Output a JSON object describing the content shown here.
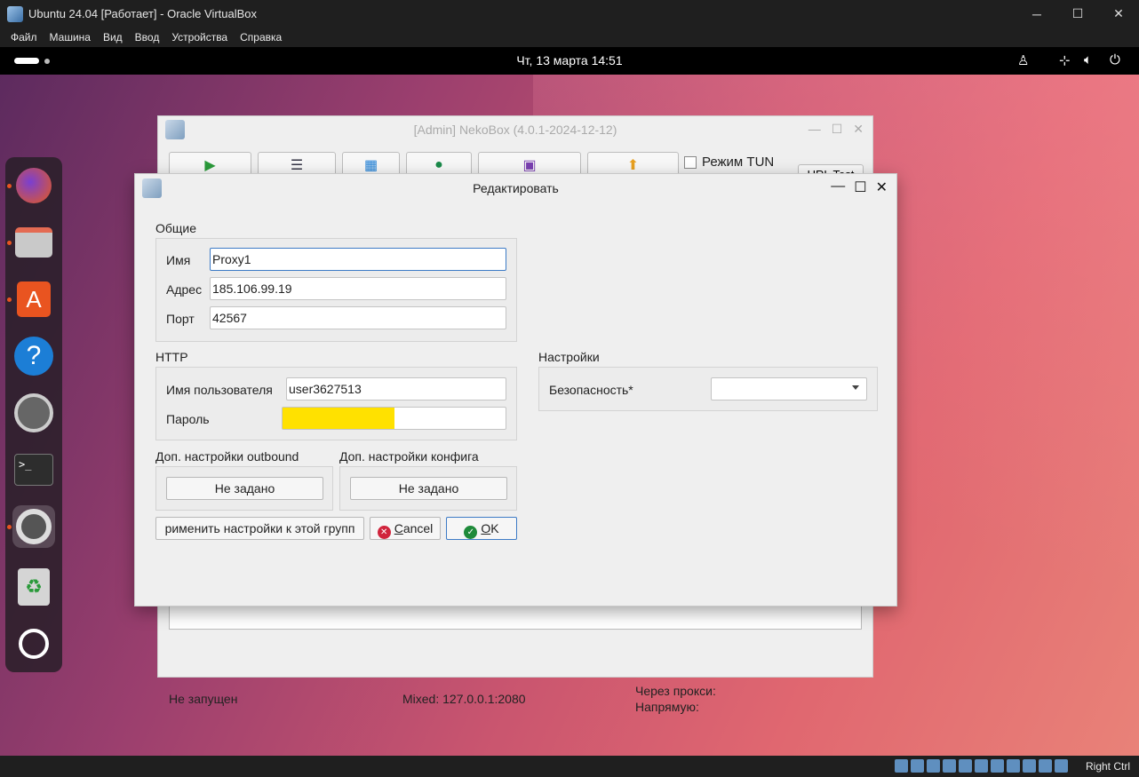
{
  "vbox": {
    "title": "Ubuntu 24.04 [Работает] - Oracle VirtualBox",
    "menu": [
      "Файл",
      "Машина",
      "Вид",
      "Ввод",
      "Устройства",
      "Справка"
    ],
    "host_key": "Right Ctrl"
  },
  "ubuntu": {
    "clock": "Чт, 13 марта  14:51"
  },
  "nekobox": {
    "title": "[Admin] NekoBox (4.0.1-2024-12-12)",
    "tun_label": "Режим TUN",
    "url_button": "URL Test",
    "status": {
      "state": "Не запущен",
      "mixed": "Mixed: 127.0.0.1:2080",
      "via_proxy": "Через прокси:",
      "direct": "Напрямую:"
    }
  },
  "dialog": {
    "title": "Редактировать",
    "general": {
      "label": "Общие",
      "name_label": "Имя",
      "name_value": "Proxy1",
      "address_label": "Адрес",
      "address_value": "185.106.99.19",
      "port_label": "Порт",
      "port_value": "42567"
    },
    "http": {
      "label": "HTTP",
      "username_label": "Имя пользователя",
      "username_value": "user3627513",
      "password_label": "Пароль"
    },
    "settings": {
      "label": "Настройки",
      "security_label": "Безопасность*",
      "security_value": ""
    },
    "outbound": {
      "label": "Доп. настройки outbound",
      "button": "Не задано"
    },
    "config": {
      "label": "Доп. настройки конфига",
      "button": "Не задано"
    },
    "buttons": {
      "apply_group": "рименить настройки к этой групп",
      "cancel_first": "C",
      "cancel_rest": "ancel",
      "ok_first": "O",
      "ok_rest": "K"
    }
  }
}
